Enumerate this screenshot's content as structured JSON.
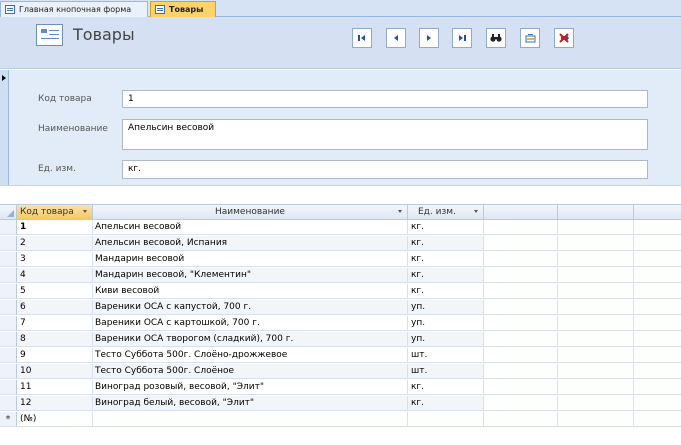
{
  "tabs": [
    {
      "label": "Главная кнопочная форма",
      "active": false
    },
    {
      "label": "Товары",
      "active": true
    }
  ],
  "form": {
    "title": "Товары",
    "buttons": [
      {
        "name": "first-record-icon"
      },
      {
        "name": "previous-record-icon"
      },
      {
        "name": "next-record-icon"
      },
      {
        "name": "last-record-icon"
      },
      {
        "name": "find-binoculars-icon"
      },
      {
        "name": "new-record-icon"
      },
      {
        "name": "delete-record-icon"
      }
    ]
  },
  "record": {
    "code_label": "Код товара",
    "code_value": "1",
    "name_label": "Наименование",
    "name_value": "Апельсин весовой",
    "unit_label": "Ед. изм.",
    "unit_value": "кг."
  },
  "grid": {
    "columns": [
      "Код товара",
      "Наименование",
      "Ед. изм."
    ],
    "rows": [
      [
        "1",
        "Апельсин весовой",
        "кг."
      ],
      [
        "2",
        "Апельсин весовой, Испания",
        "кг."
      ],
      [
        "3",
        "Мандарин весовой",
        "кг."
      ],
      [
        "4",
        "Мандарин весовой, \"Клементин\"",
        "кг."
      ],
      [
        "5",
        "Киви весовой",
        "кг."
      ],
      [
        "6",
        "Вареники ОСА с капустой, 700 г.",
        "уп."
      ],
      [
        "7",
        "Вареники ОСА с картошкой, 700 г.",
        "уп."
      ],
      [
        "8",
        "Вареники ОСА творогом (сладкий), 700 г.",
        "уп."
      ],
      [
        "9",
        "Тесто Суббота 500г. Слоёно-дрожжевое",
        "шт."
      ],
      [
        "10",
        "Тесто Суббота 500г. Слоёное",
        "шт."
      ],
      [
        "11",
        "Виноград розовый, весовой, \"Элит\"",
        "кг."
      ],
      [
        "12",
        "Виноград белый, весовой, \"Элит\"",
        "кг."
      ]
    ],
    "new_row_marker": "*",
    "new_row_code": "(№)"
  },
  "colors": {
    "active_tab": "#fbd36a",
    "header_bg": "#d5e1f2",
    "record_bg": "#e2ecf8"
  }
}
